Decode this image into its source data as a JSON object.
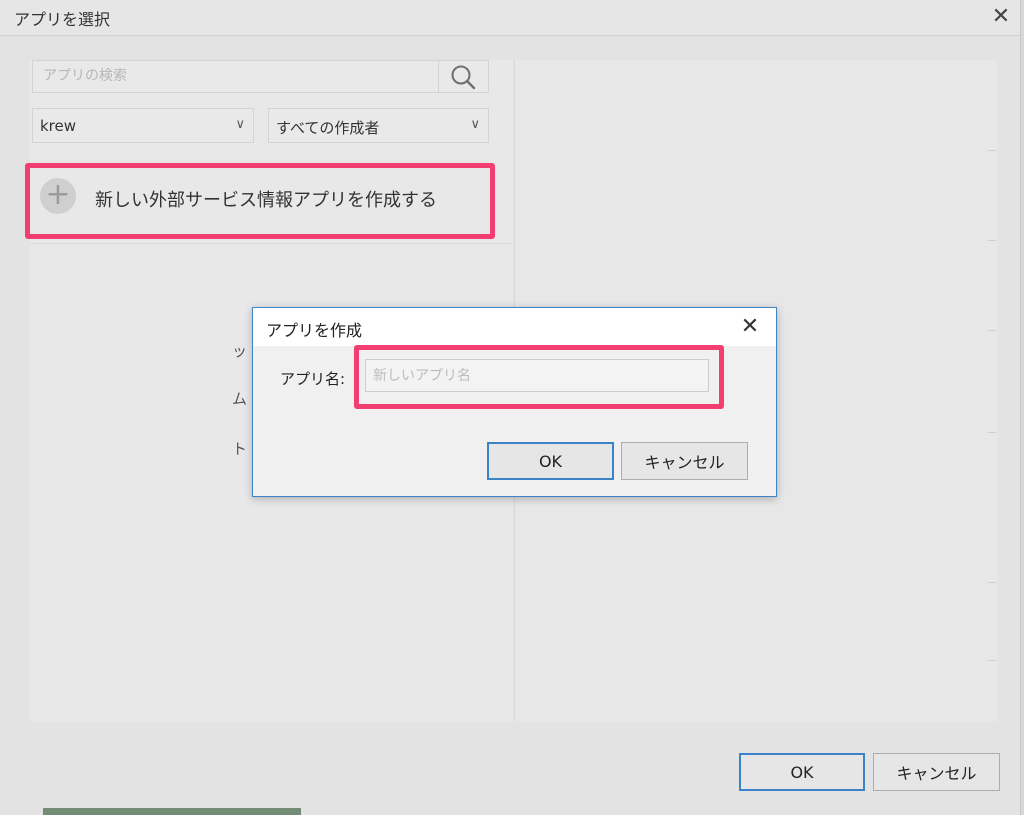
{
  "outer_dialog": {
    "title": "アプリを選択",
    "close_icon": "✕",
    "search": {
      "placeholder": "アプリの検索",
      "icon": "search-icon"
    },
    "space_select": {
      "value": "krew",
      "chevron": "∨"
    },
    "author_select": {
      "value": "すべての作成者",
      "chevron": "∨"
    },
    "create_row": {
      "plus": "+",
      "label": "新しい外部サービス情報アプリを作成する"
    },
    "footer": {
      "ok_label": "OK",
      "cancel_label": "キャンセル"
    },
    "partial_text": [
      "ッ",
      "ム",
      "ト"
    ],
    "highlight_color": "#f23e71"
  },
  "modal": {
    "title": "アプリを作成",
    "close_icon": "✕",
    "name_label": "アプリ名:",
    "name_value": "",
    "name_placeholder": "新しいアプリ名",
    "ok_label": "OK",
    "cancel_label": "キャンセル",
    "accent_color": "#3a83c9"
  }
}
